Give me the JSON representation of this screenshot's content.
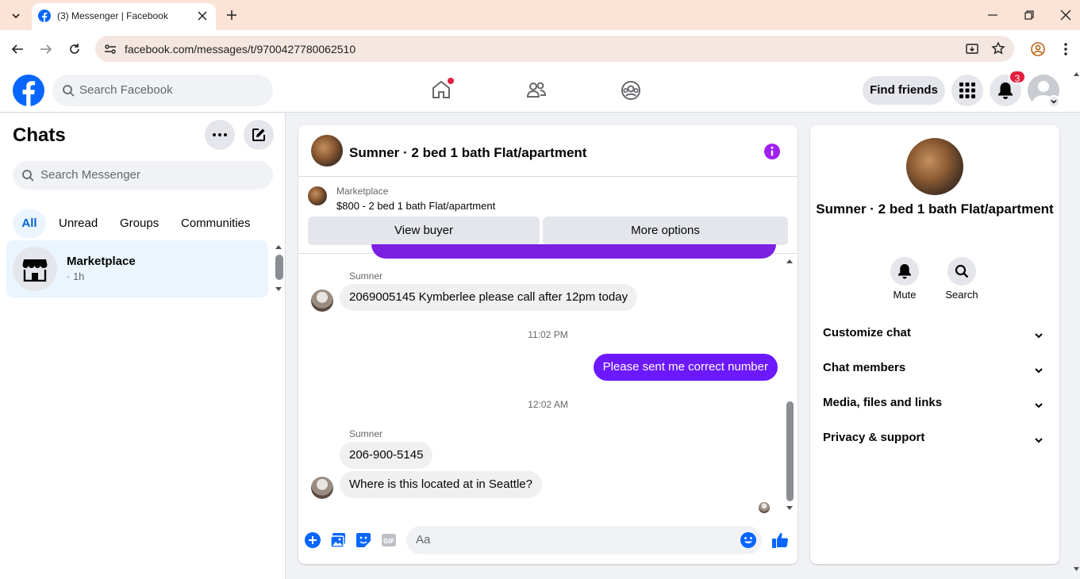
{
  "browser": {
    "tab_title": "(3) Messenger | Facebook",
    "url": "facebook.com/messages/t/9700427780062510"
  },
  "fb_header": {
    "search_placeholder": "Search Facebook",
    "find_friends": "Find friends",
    "notification_count": "3"
  },
  "left": {
    "title": "Chats",
    "search_placeholder": "Search Messenger",
    "filters": [
      "All",
      "Unread",
      "Groups",
      "Communities"
    ],
    "conversation": {
      "name": "Marketplace",
      "time": "· 1h"
    }
  },
  "chat": {
    "title": "Sumner · 2 bed 1 bath Flat/apartment",
    "marketplace_label": "Marketplace",
    "listing": "$800 - 2 bed 1 bath Flat/apartment",
    "view_buyer": "View buyer",
    "more_options": "More options",
    "messages": [
      {
        "sender": "Sumner",
        "text": "2069005145 Kymberlee please call after 12pm today"
      },
      {
        "timestamp": "11:02 PM"
      },
      {
        "outgoing": true,
        "text": "Please sent me correct number"
      },
      {
        "timestamp": "12:02 AM"
      },
      {
        "sender": "Sumner",
        "text": "206-900-5145"
      },
      {
        "text": "Where is this located at in Seattle?"
      }
    ],
    "composer_placeholder": "Aa"
  },
  "info": {
    "name": "Sumner · 2 bed 1 bath Flat/apartment",
    "mute_label": "Mute",
    "search_label": "Search",
    "sections": [
      "Customize chat",
      "Chat members",
      "Media, files and links",
      "Privacy & support"
    ]
  },
  "colors": {
    "brand": "#0866ff",
    "outgoing_bubble": "#6c19ff",
    "info_icon": "#a020f0",
    "notif": "#e41e3f"
  }
}
